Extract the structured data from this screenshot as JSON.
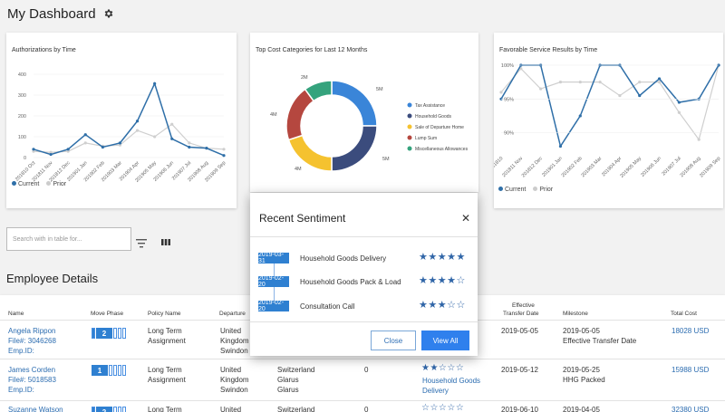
{
  "header": {
    "title": "My Dashboard",
    "settings_icon": "gear-icon"
  },
  "charts": {
    "authorizations": {
      "title": "Authorizations by Time",
      "yticks": [
        "400",
        "300",
        "200",
        "100",
        "0"
      ],
      "xticks": [
        "201810 Oct",
        "201811 Nov",
        "201812 Dec",
        "201901 Jan",
        "201902 Feb",
        "201903 Mar",
        "201904 Apr",
        "201905 May",
        "201906 Jun",
        "201907 Jul",
        "201908 Aug",
        "201909 Sep"
      ],
      "legend": {
        "current": "Current",
        "prior": "Prior"
      }
    },
    "top_cost": {
      "title": "Top Cost Categories for Last 12 Months",
      "slice_labels": [
        "5M",
        "5M",
        "4M",
        "4M",
        "2M"
      ],
      "legend": [
        "Tax Assistance",
        "Household Goods",
        "Sale of Departure Home",
        "Lump Sum",
        "Miscellaneous Allowances"
      ]
    },
    "favorable": {
      "title": "Favorable Service Results by Time",
      "yticks": [
        "100%",
        "95%",
        "90%"
      ],
      "xticks": [
        "201810",
        "201811 Nov",
        "201812 Dec",
        "201901 Jan",
        "201902 Feb",
        "201903 Mar",
        "201904 Apr",
        "201905 May",
        "201906 Jun",
        "201907 Jul",
        "201908 Aug",
        "201909 Sep"
      ],
      "legend": {
        "current": "Current",
        "prior": "Prior"
      }
    }
  },
  "chart_data": [
    {
      "type": "line",
      "title": "Authorizations by Time",
      "x": [
        "201810 Oct",
        "201811 Nov",
        "201812 Dec",
        "201901 Jan",
        "201902 Feb",
        "201903 Mar",
        "201904 Apr",
        "201905 May",
        "201906 Jun",
        "201907 Jul",
        "201908 Aug",
        "201909 Sep"
      ],
      "ylim": [
        0,
        400
      ],
      "series": [
        {
          "name": "Current",
          "values": [
            40,
            15,
            40,
            110,
            50,
            70,
            175,
            355,
            90,
            50,
            45,
            10
          ]
        },
        {
          "name": "Prior",
          "values": [
            30,
            25,
            30,
            70,
            55,
            60,
            130,
            100,
            160,
            70,
            45,
            40
          ]
        }
      ]
    },
    {
      "type": "pie",
      "title": "Top Cost Categories for Last 12 Months",
      "categories": [
        "Tax Assistance",
        "Household Goods",
        "Sale of Departure Home",
        "Lump Sum",
        "Miscellaneous Allowances"
      ],
      "values": [
        5,
        5,
        4,
        4,
        2
      ],
      "colors": [
        "#3a85d8",
        "#3b4c7d",
        "#f5c22f",
        "#b5473f",
        "#35a37d"
      ]
    },
    {
      "type": "line",
      "title": "Favorable Service Results by Time",
      "x": [
        "201810",
        "201811 Nov",
        "201812 Dec",
        "201901 Jan",
        "201902 Feb",
        "201903 Mar",
        "201904 Apr",
        "201905 May",
        "201906 Jun",
        "201907 Jul",
        "201908 Aug",
        "201909 Sep"
      ],
      "ylim": [
        87,
        100
      ],
      "series": [
        {
          "name": "Current",
          "values": [
            95,
            100,
            100,
            88,
            92.5,
            100,
            100,
            95.5,
            98,
            94.5,
            95,
            100
          ]
        },
        {
          "name": "Prior",
          "values": [
            96,
            99.5,
            96.5,
            97.5,
            97.5,
            97.5,
            95.5,
            97.5,
            97.5,
            93,
            89,
            100
          ]
        }
      ]
    }
  ],
  "toolbar": {
    "search_placeholder": "Search with in table for...",
    "filter_icon": "filter-icon",
    "columns_icon": "columns-icon"
  },
  "employee_section": {
    "title": "Employee Details"
  },
  "table": {
    "headers": {
      "name": "Name",
      "move_phase": "Move Phase",
      "policy_name": "Policy Name",
      "departure": "Departure",
      "effective_l1": "Effective",
      "effective_l2": "Transfer Date",
      "milestone": "Milestone",
      "total_cost": "Total Cost"
    },
    "rows": [
      {
        "name": "Angela Rippon",
        "file": "File#: 3046268",
        "emp": "Emp.ID:",
        "phase": "2",
        "policy_l1": "Long Term",
        "policy_l2": "Assignment",
        "dep_l1": "United",
        "dep_l2": "Kingdom",
        "dep_l3": "Swindon",
        "effective": "2019-05-05",
        "milestone_l1": "2019-05-05",
        "milestone_l2": "Effective Transfer Date",
        "total_cost": "18028 USD"
      },
      {
        "name": "James Corden",
        "file": "File#: 5018583",
        "emp": "Emp.ID:",
        "phase": "1",
        "policy_l1": "Long Term",
        "policy_l2": "Assignment",
        "dep_l1": "United",
        "dep_l2": "Kingdom",
        "dep_l3": "Swindon",
        "dest_l1": "Switzerland",
        "dest_l2": "Glarus",
        "dest_l3": "Glarus",
        "count": "0",
        "stars": "★★☆☆☆",
        "sentiment_l1": "Household Goods",
        "sentiment_l2": "Delivery",
        "effective": "2019-05-12",
        "milestone_l1": "2019-05-25",
        "milestone_l2": "HHG Packed",
        "total_cost": "15988 USD"
      },
      {
        "name": "Suzanne Watson",
        "phase": "2",
        "policy_l1": "Long Term",
        "dep_l1": "United",
        "dest_l1": "Switzerland",
        "count": "0",
        "stars": "☆☆☆☆☆",
        "effective": "2019-06-10",
        "milestone_l1": "2019-04-05",
        "total_cost": "32380 USD"
      }
    ]
  },
  "modal": {
    "title": "Recent Sentiment",
    "close_icon": "close-icon",
    "items": [
      {
        "date": "2019-03-31",
        "label": "Household Goods Delivery",
        "stars": "★★★★★"
      },
      {
        "date": "2019-02-20",
        "label": "Household Goods Pack & Load",
        "stars": "★★★★☆"
      },
      {
        "date": "2019-02-20",
        "label": "Consultation Call",
        "stars": "★★★☆☆"
      }
    ],
    "close_label": "Close",
    "view_all_label": "View All"
  }
}
